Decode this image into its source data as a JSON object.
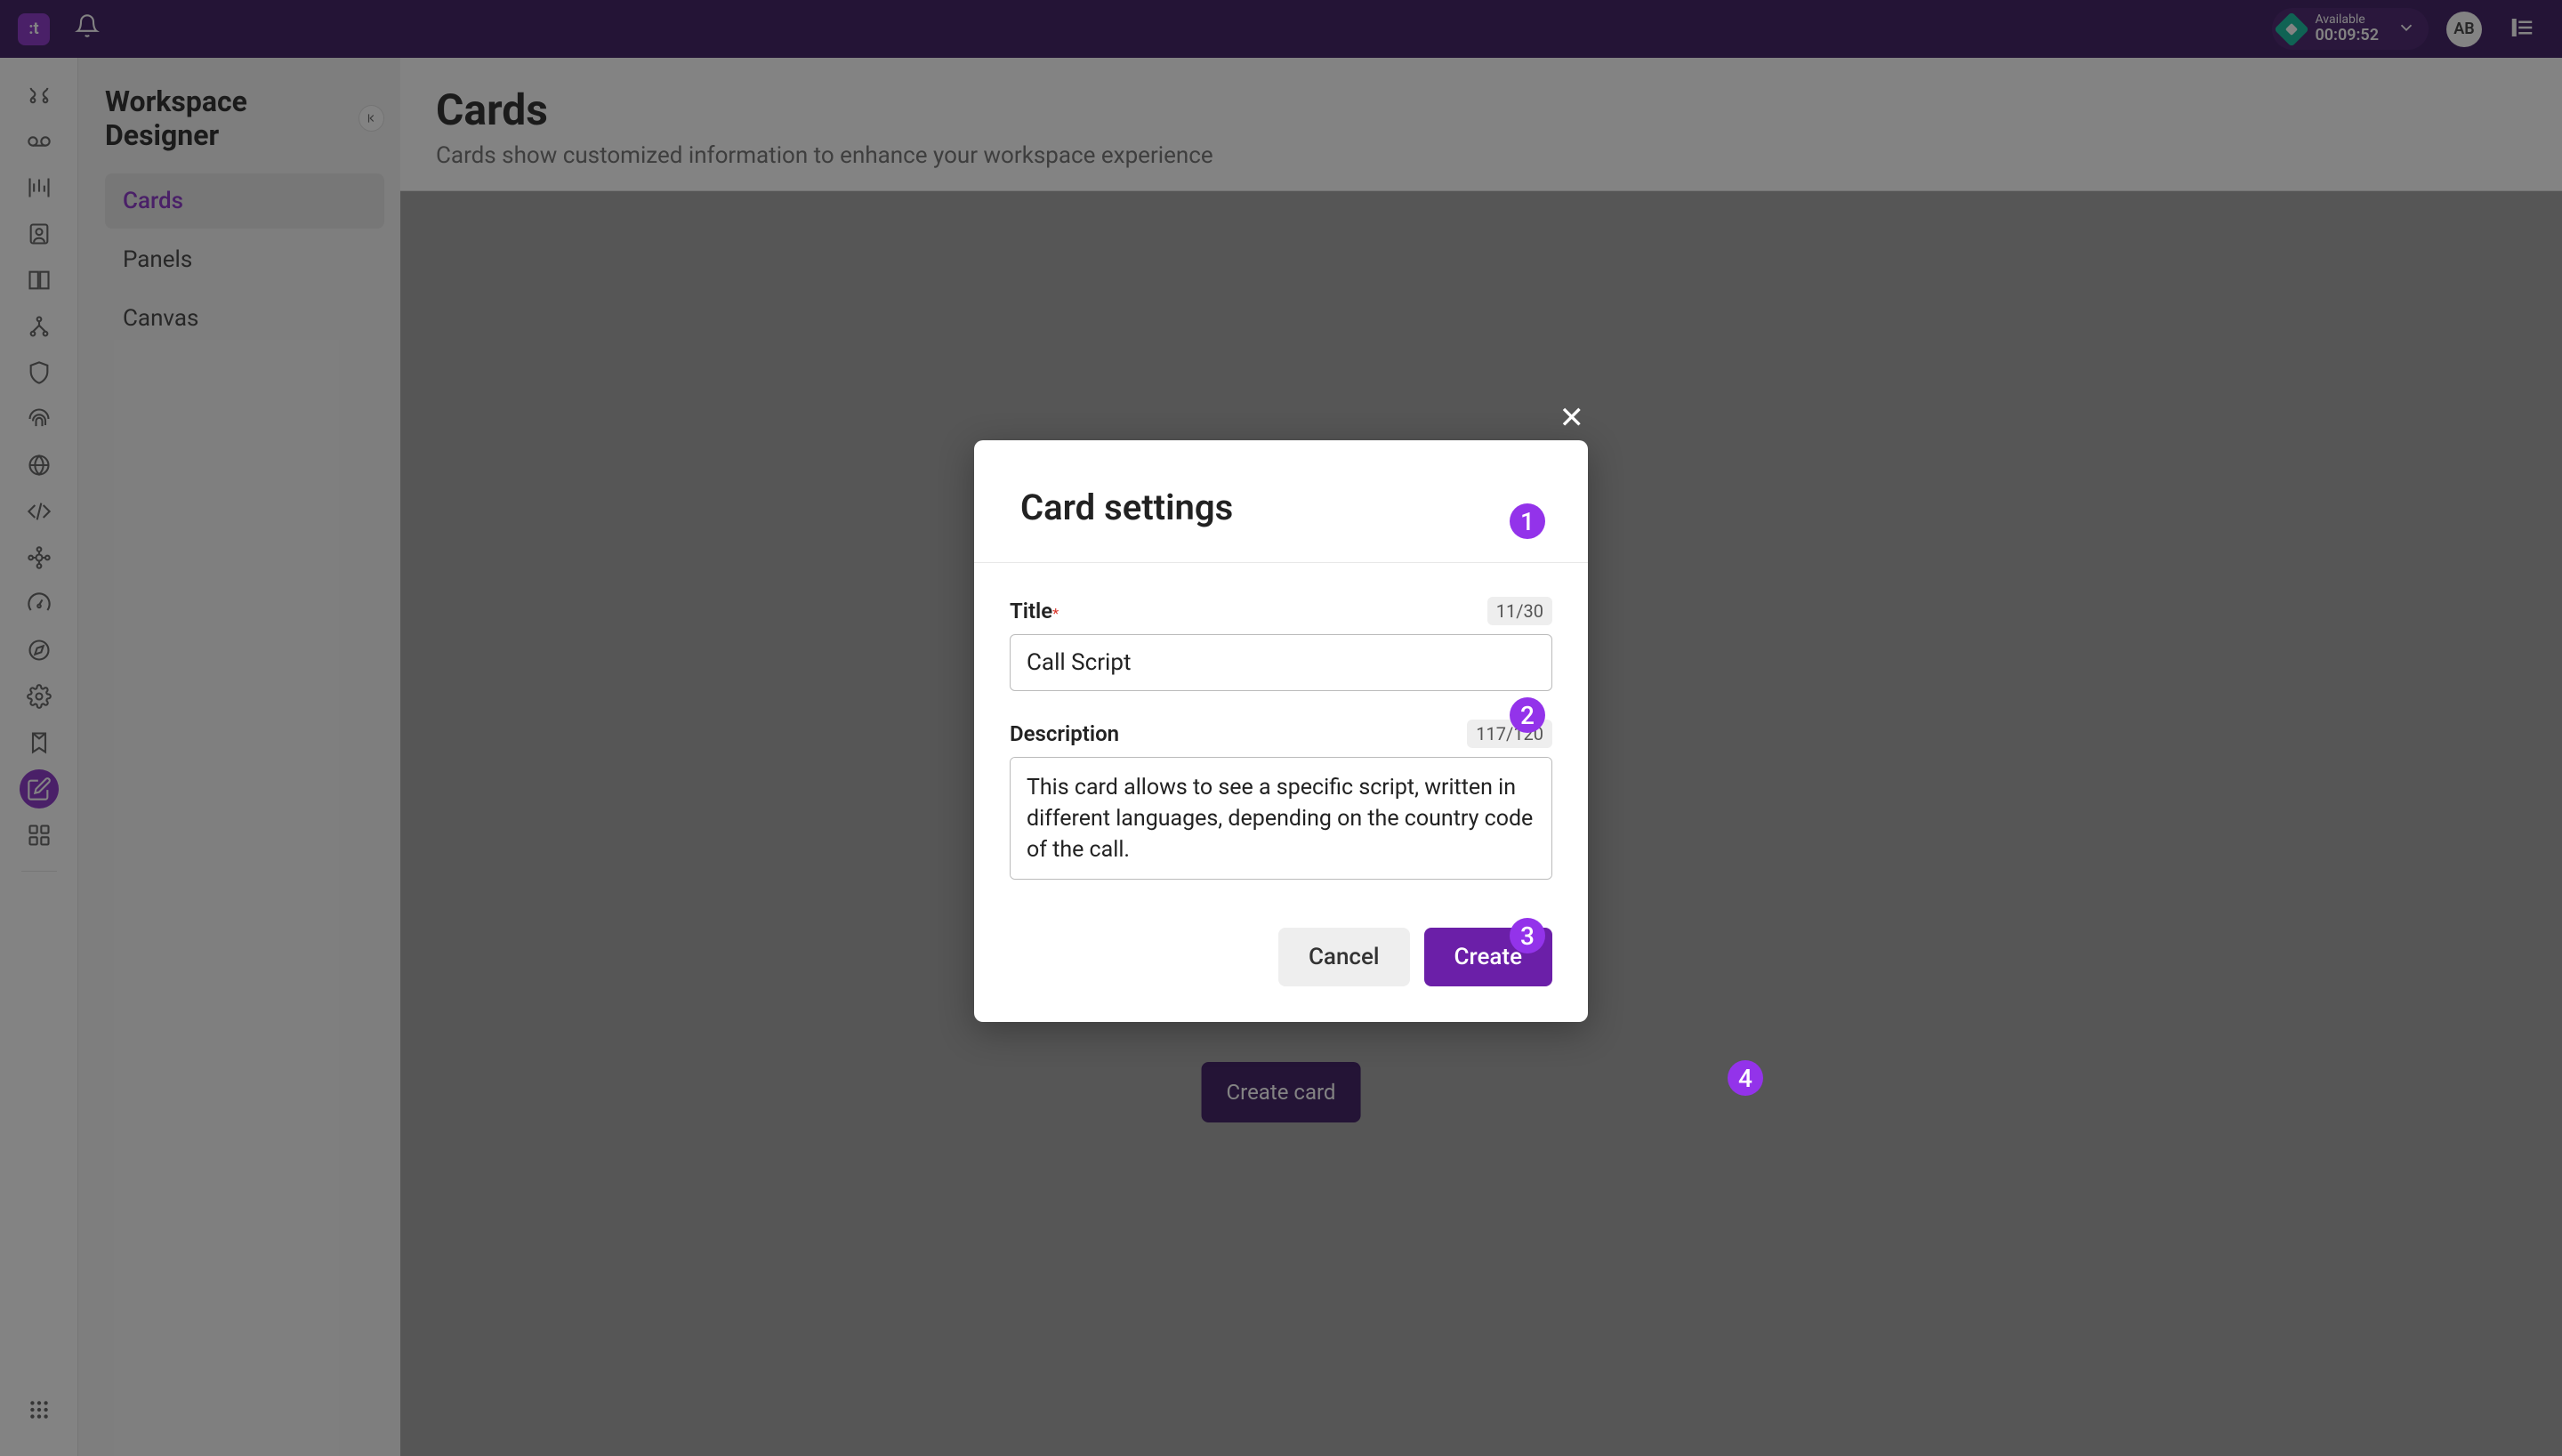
{
  "header": {
    "status_label": "Available",
    "status_timer": "00:09:52",
    "avatar_initials": "AB"
  },
  "sidebar": {
    "title": "Workspace Designer",
    "items": [
      {
        "label": "Cards",
        "active": true
      },
      {
        "label": "Panels",
        "active": false
      },
      {
        "label": "Canvas",
        "active": false
      }
    ]
  },
  "page": {
    "title": "Cards",
    "subtitle": "Cards show customized information to enhance your workspace experience",
    "create_button": "Create card"
  },
  "modal": {
    "title": "Card settings",
    "fields": {
      "title_label": "Title",
      "title_counter": "11/30",
      "title_value": "Call Script",
      "desc_label": "Description",
      "desc_counter": "117/120",
      "desc_value": "This card allows to see a specific script, written in different languages, depending on the country code of the call."
    },
    "cancel_label": "Cancel",
    "create_label": "Create"
  },
  "annotations": {
    "b1": "1",
    "b2": "2",
    "b3": "3",
    "b4": "4"
  }
}
